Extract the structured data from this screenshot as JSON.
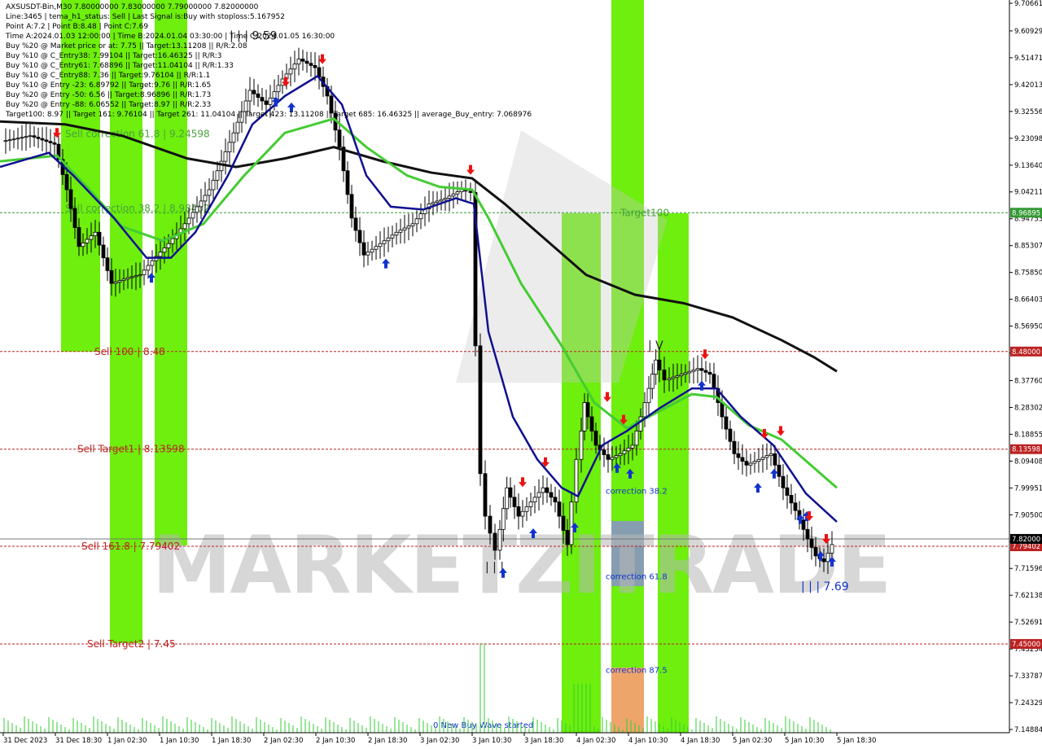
{
  "header": {
    "lines": [
      "AXSUSDT-Bin,M30  7.80000000 7.83000000 7.79000000 7.82000000",
      "Line:3465 | tema_h1_status: Sell | Last Signal is:Buy with stoploss:5.167952",
      "Point A:7.2 | Point B:8.48 | Point C:7.69",
      "Time A:2024.01.03 12:00:00 | Time B:2024.01.04 03:30:00 | Time C:2024.01.05 16:30:00",
      "Buy %20 @ Market price or at: 7.75 || Target:13.11208 || R/R:2.08",
      "Buy %10 @ C_Entry38: 7.99104 || Target:16.46325 || R/R:3",
      "Buy %10 @ C_Entry61: 7.68896 || Target:11.04104 || R/R:1.33",
      "Buy %10 @ C_Entry88: 7.36 || Target:9.76104 || R/R:1.1",
      "Buy %10 @ Entry -23: 6.89792 || Target:9.76 || R/R:1.65",
      "Buy %20 @ Entry -50: 6.56 || Target:8.96896 || R/R:1.73",
      "Buy %20 @ Entry -88: 6.06552 || Target:8.97 || R/R:2.33",
      "Target100: 8.97 || Target 161: 9.76104 || Target 261: 11.04104 || Target 423: 13.11208 || Target 685: 16.46325 || average_Buy_entry: 7.068976"
    ]
  },
  "chart_data": {
    "type": "candlestick",
    "symbol": "AXSUSDT-Bin",
    "timeframe": "M30",
    "ylim": [
      7.14884,
      9.70661
    ],
    "y_ticks": [
      9.70661,
      9.60929,
      9.51471,
      9.42013,
      9.32556,
      9.23098,
      9.1364,
      9.04211,
      8.94753,
      8.85307,
      8.7585,
      8.66403,
      8.5695,
      8.475,
      8.3776,
      8.28302,
      8.18855,
      8.09408,
      7.99951,
      7.905,
      7.81042,
      7.71596,
      7.62138,
      7.52691,
      7.43234,
      7.33787,
      7.24329,
      7.14884
    ],
    "x_ticks": [
      "31 Dec 2023",
      "31 Dec 18:30",
      "1 Jan 02:30",
      "1 Jan 10:30",
      "1 Jan 18:30",
      "2 Jan 02:30",
      "2 Jan 10:30",
      "2 Jan 18:30",
      "3 Jan 02:30",
      "3 Jan 10:30",
      "3 Jan 18:30",
      "4 Jan 02:30",
      "4 Jan 10:30",
      "4 Jan 18:30",
      "5 Jan 02:30",
      "5 Jan 10:30",
      "5 Jan 18:30"
    ],
    "horizontal_levels": [
      {
        "label": "Sell correction 61.8 | 9.24598",
        "value": 9.24598,
        "style": "none"
      },
      {
        "label": "Sell correction 38.2 | 8.98402",
        "value": 8.98402,
        "style": "none"
      },
      {
        "label": "Target100",
        "value": 8.96895,
        "style": "dotted-green",
        "badge": "8.96895"
      },
      {
        "label": "Sell 100 | 8.48",
        "value": 8.48,
        "style": "dotted-red",
        "badge": "8.48000"
      },
      {
        "label": "Sell Target1 | 8.13598",
        "value": 8.13598,
        "style": "dotted-red",
        "badge": "8.13598"
      },
      {
        "label": "Sell 161.8 | 7.79402",
        "value": 7.79402,
        "style": "dotted-red",
        "badge": "7.79402"
      },
      {
        "label": "Sell Target2 | 7.45",
        "value": 7.45,
        "style": "dotted-red",
        "badge": "7.45000"
      },
      {
        "label": "",
        "value": 7.82,
        "style": "solid-gray",
        "badge": "7.82000"
      }
    ],
    "correction_labels": [
      {
        "label": "correction 38.2",
        "value": 7.99
      },
      {
        "label": "correction 61.8",
        "value": 7.69
      },
      {
        "label": "correction 87.5",
        "value": 7.36
      }
    ],
    "wave_labels": [
      {
        "label": "| | | 9.59",
        "value": 9.59
      },
      {
        "label": "| | |",
        "value": 7.72
      },
      {
        "label": "| V",
        "value": 8.5
      },
      {
        "label": "| | | 7.69",
        "value": 7.65
      }
    ],
    "footer_label": "0 New Buy Wave started",
    "watermark": "MARKETZITRADE",
    "colors": {
      "green_zone": "#66ee00",
      "orange_zone": "#f4a070",
      "blue_zone": "#8899bb",
      "ema_black": "#111111",
      "ema_green": "#44cc33",
      "ema_blue": "#101090",
      "sell_line": "#bb2222",
      "target_line": "#339933",
      "buy_arrow": "#1133cc",
      "sell_arrow": "#ee1111"
    }
  }
}
